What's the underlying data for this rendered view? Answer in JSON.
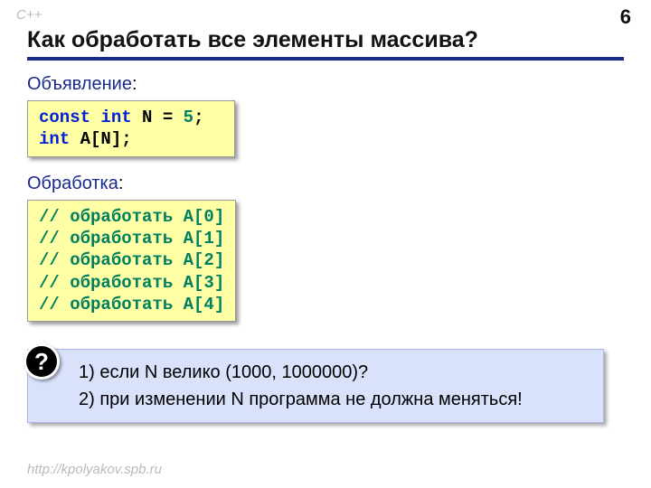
{
  "header": {
    "lang": "C++",
    "page": "6",
    "title": "Как обработать все элементы массива?"
  },
  "sections": {
    "declaration": {
      "label": "Объявление",
      "code": {
        "line1": {
          "kw1": "const",
          "kw2": "int",
          "name": "N",
          "eq": "=",
          "val": "5",
          "semi": ";"
        },
        "line2": {
          "kw": "int",
          "rest": "A[N];"
        }
      }
    },
    "processing": {
      "label": "Обработка",
      "code": {
        "c0": "// обработать A[0]",
        "c1": "// обработать A[1]",
        "c2": "// обработать A[2]",
        "c3": "// обработать A[3]",
        "c4": "// обработать A[4]"
      }
    }
  },
  "callout": {
    "badge": "?",
    "q1": "1) если N велико (1000, 1000000)?",
    "q2": "2) при изменении N программа не должна меняться!"
  },
  "footer": {
    "url": "http://kpolyakov.spb.ru"
  }
}
